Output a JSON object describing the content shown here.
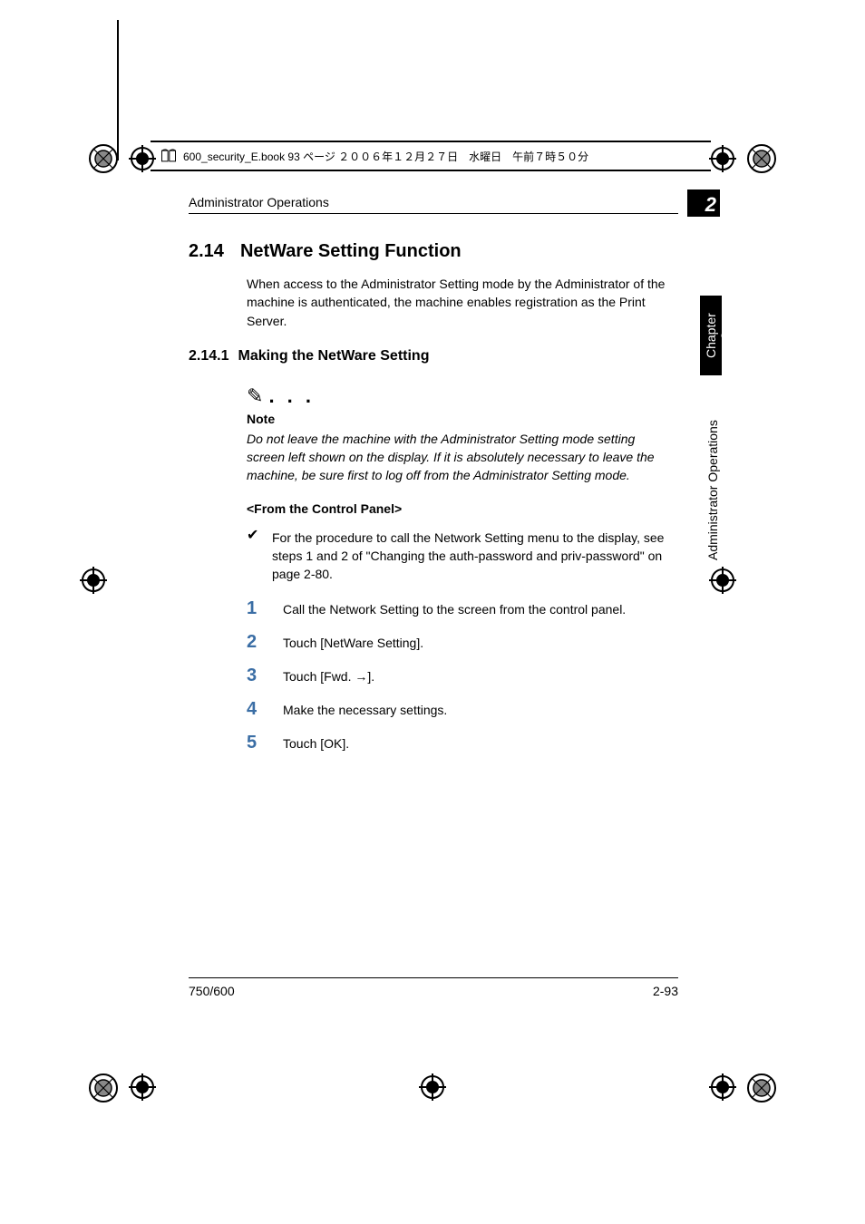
{
  "docfile": {
    "text": "600_security_E.book  93 ページ  ２００６年１２月２７日　水曜日　午前７時５０分"
  },
  "running_head": "Administrator Operations",
  "chapter_box": "2",
  "section": {
    "number": "2.14",
    "title": "NetWare Setting Function",
    "intro": "When access to the Administrator Setting mode by the Administrator of the machine is authenticated, the machine enables registration as the Print Server."
  },
  "subsection": {
    "number": "2.14.1",
    "title": "Making the NetWare Setting"
  },
  "note": {
    "label": "Note",
    "text": "Do not leave the machine with the Administrator Setting mode setting screen left shown on the display. If it is absolutely necessary to leave the machine, be sure first to log off from the Administrator Setting mode."
  },
  "subhead": "<From the Control Panel>",
  "checklist": "For the procedure to call the Network Setting menu to the display, see steps 1 and 2 of \"Changing the auth-password and priv-password\" on page 2-80.",
  "steps": [
    "Call the Network Setting to the screen from the control panel.",
    "Touch [NetWare Setting].",
    "Touch [Fwd. →].",
    "Make the necessary settings.",
    "Touch [OK]."
  ],
  "side": {
    "chapter": "Chapter 2",
    "section": "Administrator Operations"
  },
  "footer": {
    "left": "750/600",
    "right": "2-93"
  }
}
